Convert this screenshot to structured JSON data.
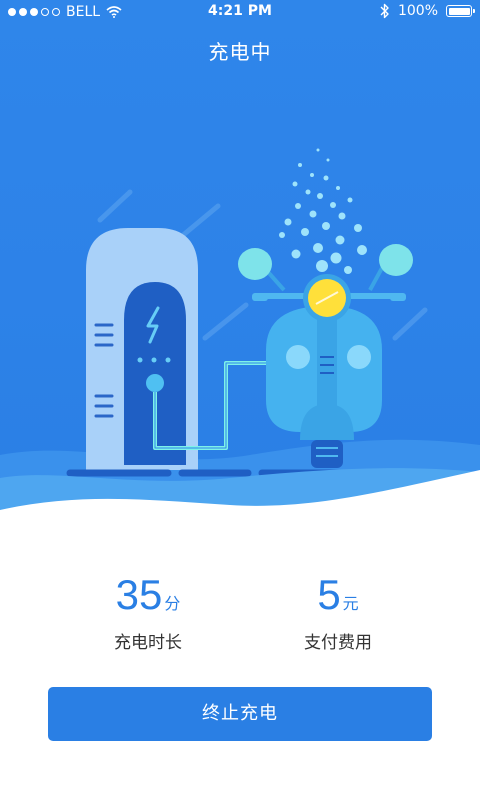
{
  "status_bar": {
    "carrier": "BELL",
    "time": "4:21 PM",
    "battery": "100%",
    "signal_icon": "signal-dots-icon",
    "wifi_icon": "wifi-icon",
    "bluetooth_icon": "bluetooth-icon",
    "battery_icon": "battery-icon"
  },
  "header": {
    "title": "充电中"
  },
  "stats": {
    "duration": {
      "value": "35",
      "unit": "分",
      "label": "充电时长"
    },
    "payment": {
      "value": "5",
      "unit": "元",
      "label": "支付费用"
    }
  },
  "actions": {
    "stop_label": "终止充电"
  },
  "colors": {
    "primary": "#2a7fe4",
    "hero_bg": "#2d82e8",
    "scooter": "#4fb8f0",
    "lamp": "#ffe03a",
    "cable_glow": "#7ef2e8",
    "text_dark": "#333333"
  }
}
